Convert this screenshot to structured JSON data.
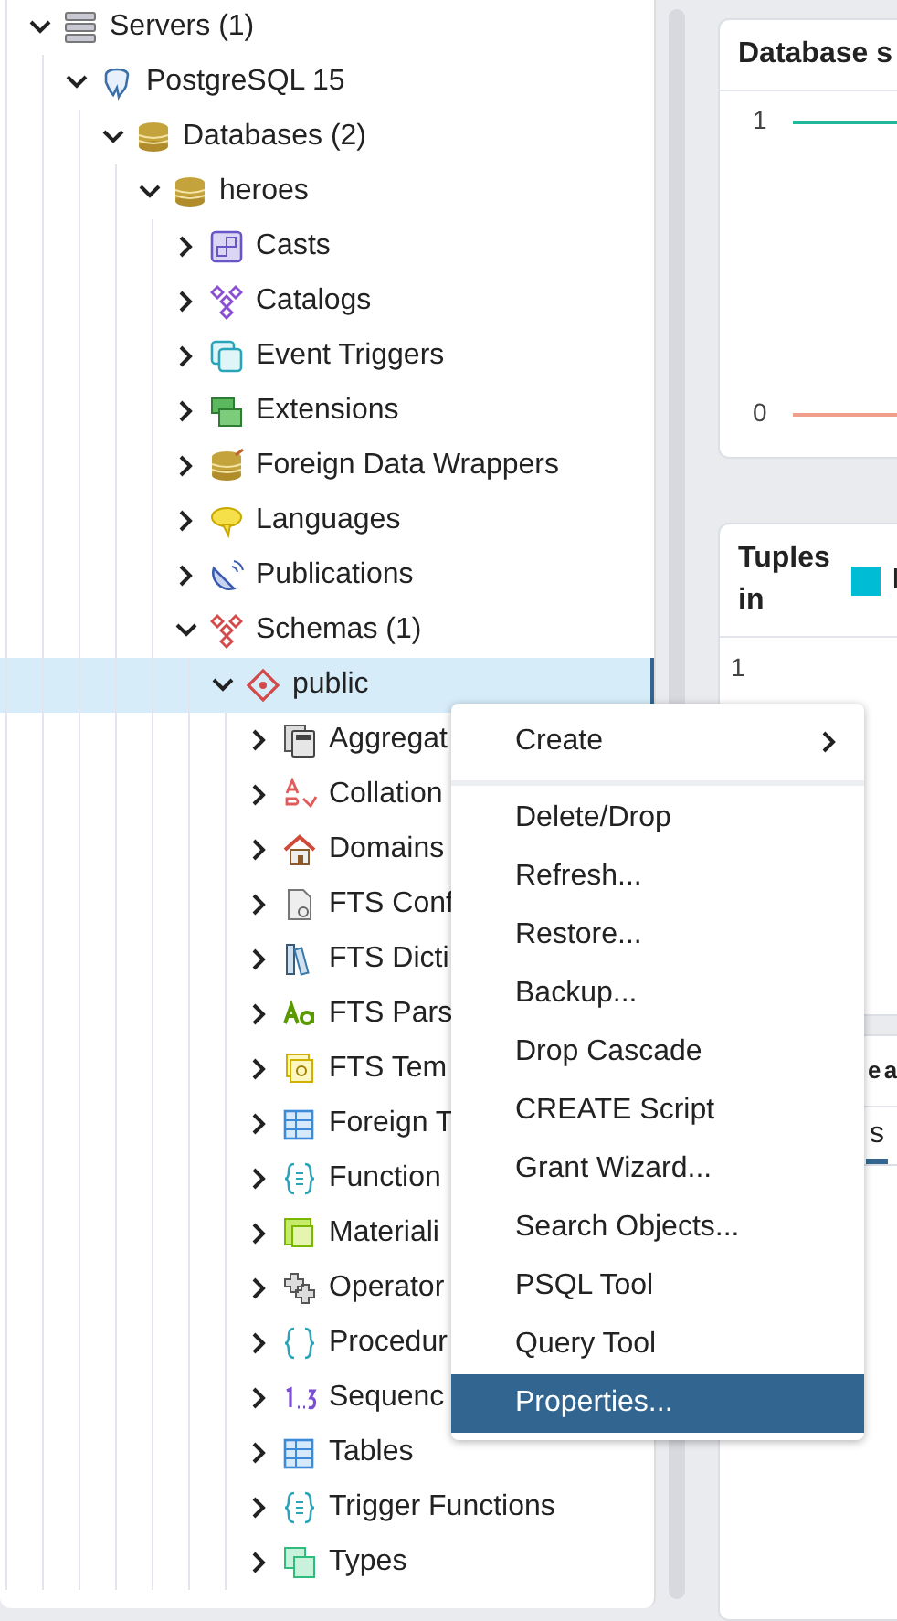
{
  "tree": [
    {
      "label": "Servers (1)",
      "kind": "servers",
      "expanded": true,
      "selected": false,
      "children": [
        {
          "label": "PostgreSQL 15",
          "kind": "server",
          "expanded": true,
          "selected": false,
          "children": [
            {
              "label": "Databases (2)",
              "kind": "databases",
              "expanded": true,
              "selected": false,
              "children": [
                {
                  "label": "heroes",
                  "kind": "database",
                  "expanded": true,
                  "selected": false,
                  "children": [
                    {
                      "label": "Casts",
                      "kind": "cast",
                      "expanded": false,
                      "selected": false
                    },
                    {
                      "label": "Catalogs",
                      "kind": "catalog",
                      "expanded": false,
                      "selected": false
                    },
                    {
                      "label": "Event Triggers",
                      "kind": "event_trigger",
                      "expanded": false,
                      "selected": false
                    },
                    {
                      "label": "Extensions",
                      "kind": "extension",
                      "expanded": false,
                      "selected": false
                    },
                    {
                      "label": "Foreign Data Wrappers",
                      "kind": "fdw",
                      "expanded": false,
                      "selected": false
                    },
                    {
                      "label": "Languages",
                      "kind": "language",
                      "expanded": false,
                      "selected": false
                    },
                    {
                      "label": "Publications",
                      "kind": "publication",
                      "expanded": false,
                      "selected": false
                    },
                    {
                      "label": "Schemas (1)",
                      "kind": "schemas",
                      "expanded": true,
                      "selected": false,
                      "children": [
                        {
                          "label": "public",
                          "kind": "schema",
                          "expanded": true,
                          "selected": true,
                          "children": [
                            {
                              "label": "Aggregat",
                              "kind": "aggregate",
                              "expanded": false,
                              "selected": false
                            },
                            {
                              "label": "Collation",
                              "kind": "collation",
                              "expanded": false,
                              "selected": false
                            },
                            {
                              "label": "Domains",
                              "kind": "domain",
                              "expanded": false,
                              "selected": false
                            },
                            {
                              "label": "FTS Conf",
                              "kind": "fts_config",
                              "expanded": false,
                              "selected": false
                            },
                            {
                              "label": "FTS Dicti",
                              "kind": "fts_dict",
                              "expanded": false,
                              "selected": false
                            },
                            {
                              "label": "FTS Pars",
                              "kind": "fts_parser",
                              "expanded": false,
                              "selected": false
                            },
                            {
                              "label": "FTS Tem",
                              "kind": "fts_template",
                              "expanded": false,
                              "selected": false
                            },
                            {
                              "label": "Foreign T",
                              "kind": "foreign_table",
                              "expanded": false,
                              "selected": false
                            },
                            {
                              "label": "Function",
                              "kind": "function",
                              "expanded": false,
                              "selected": false
                            },
                            {
                              "label": "Materiali",
                              "kind": "matview",
                              "expanded": false,
                              "selected": false
                            },
                            {
                              "label": "Operator",
                              "kind": "operator",
                              "expanded": false,
                              "selected": false
                            },
                            {
                              "label": "Procedur",
                              "kind": "procedure",
                              "expanded": false,
                              "selected": false
                            },
                            {
                              "label": "Sequenc",
                              "kind": "sequence",
                              "expanded": false,
                              "selected": false
                            },
                            {
                              "label": "Tables",
                              "kind": "table",
                              "expanded": false,
                              "selected": false
                            },
                            {
                              "label": "Trigger Functions",
                              "kind": "trigger_function",
                              "expanded": false,
                              "selected": false
                            },
                            {
                              "label": "Types",
                              "kind": "type",
                              "expanded": false,
                              "selected": false
                            }
                          ]
                        }
                      ]
                    }
                  ]
                }
              ]
            }
          ]
        }
      ]
    }
  ],
  "dashboard": {
    "cards": [
      {
        "title": "Database s",
        "tick_labels": [
          "1",
          "0"
        ]
      },
      {
        "title": "Tuples in",
        "legend": [
          {
            "label": "I",
            "color": "#00bcd4"
          }
        ],
        "tick_label": "1"
      },
      {
        "title": "e a",
        "tabs": [
          {
            "label": "s",
            "selected": true
          }
        ]
      }
    ]
  },
  "context_menu": {
    "items": [
      {
        "label": "Create",
        "kind": "submenu",
        "selected": false
      },
      {
        "kind": "separator"
      },
      {
        "label": "Delete/Drop",
        "kind": "item",
        "selected": false
      },
      {
        "label": "Refresh...",
        "kind": "item",
        "selected": false
      },
      {
        "label": "Restore...",
        "kind": "item",
        "selected": false
      },
      {
        "label": "Backup...",
        "kind": "item",
        "selected": false
      },
      {
        "label": "Drop Cascade",
        "kind": "item",
        "selected": false
      },
      {
        "label": "CREATE Script",
        "kind": "item",
        "selected": false
      },
      {
        "label": "Grant Wizard...",
        "kind": "item",
        "selected": false
      },
      {
        "label": "Search Objects...",
        "kind": "item",
        "selected": false
      },
      {
        "label": "PSQL Tool",
        "kind": "item",
        "selected": false
      },
      {
        "label": "Query Tool",
        "kind": "item",
        "selected": false
      },
      {
        "label": "Properties...",
        "kind": "item",
        "selected": true
      }
    ]
  }
}
